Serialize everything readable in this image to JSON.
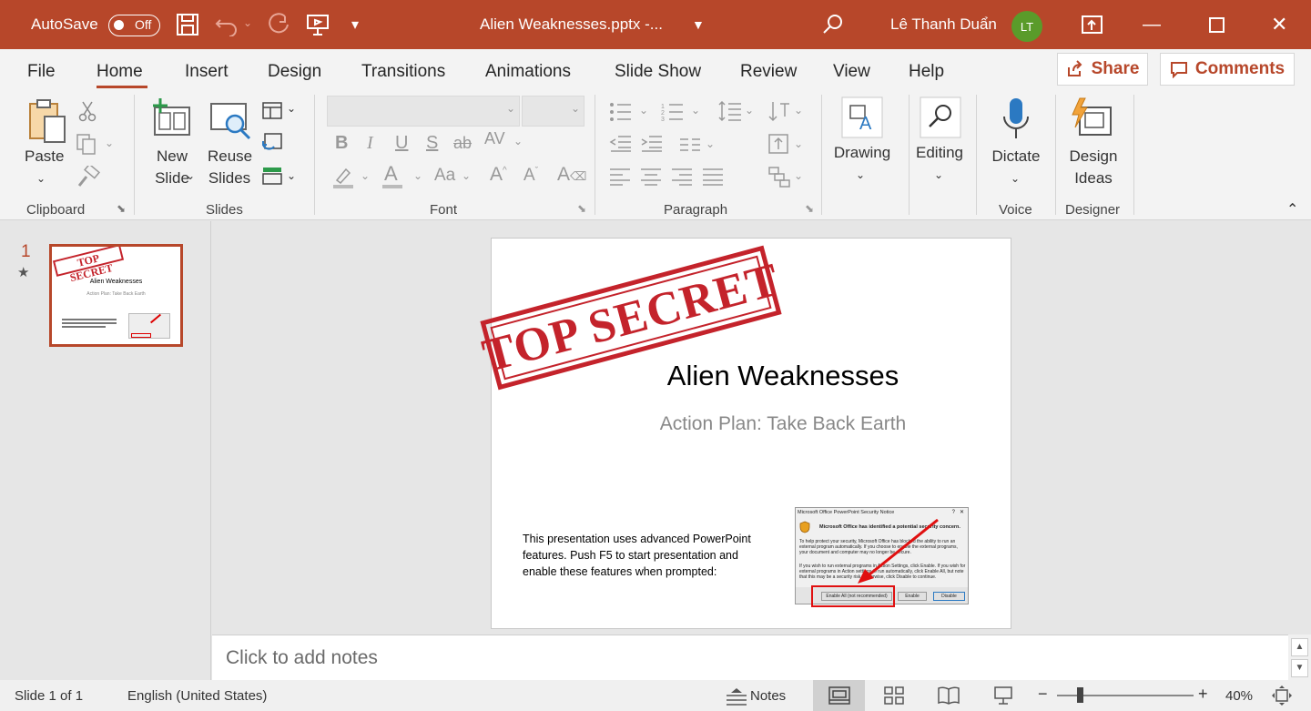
{
  "titlebar": {
    "autosave_label": "AutoSave",
    "autosave_state": "Off",
    "doc_title": "Alien Weaknesses.pptx  -...",
    "user_name": "Lê Thanh Duẩn",
    "user_initials": "LT"
  },
  "tabs": [
    "File",
    "Home",
    "Insert",
    "Design",
    "Transitions",
    "Animations",
    "Slide Show",
    "Review",
    "View",
    "Help"
  ],
  "active_tab": "Home",
  "share_label": "Share",
  "comments_label": "Comments",
  "ribbon": {
    "paste": "Paste",
    "clipboard": "Clipboard",
    "new_slide_1": "New",
    "new_slide_2": "Slide",
    "reuse_1": "Reuse",
    "reuse_2": "Slides",
    "slides": "Slides",
    "font": "Font",
    "paragraph": "Paragraph",
    "drawing": "Drawing",
    "editing": "Editing",
    "dictate": "Dictate",
    "voice": "Voice",
    "design_1": "Design",
    "design_2": "Ideas",
    "designer": "Designer"
  },
  "thumbnail": {
    "number": "1",
    "title": "Alien Weaknesses",
    "subtitle": "Action Plan: Take Back Earth",
    "stamp": "TOP SECRET"
  },
  "slide": {
    "stamp": "TOP SECRET",
    "title": "Alien Weaknesses",
    "subtitle": "Action Plan: Take Back Earth",
    "body": "This presentation uses advanced PowerPoint features. Push F5 to start presentation and enable these features when prompted:",
    "dialog": {
      "title": "Microsoft Office PowerPoint Security Notice",
      "heading": "Microsoft Office has identified a potential security concern.",
      "p1": "To help protect your security, Microsoft Office has blocked the ability to run an external program automatically.  If you choose to enable the external programs, your document and computer may no longer be secure.",
      "p2": "If you wish to run external programs in Action Settings, click Enable. If you wish for external programs in Action settings to run automatically, click Enable All, but note that this may be a security risk.  Otherwise, click Disable to continue.",
      "btn_enable_all": "Enable All (not recommended)",
      "btn_enable": "Enable",
      "btn_disable": "Disable"
    }
  },
  "notes_placeholder": "Click to add notes",
  "status": {
    "slide_info": "Slide 1 of 1",
    "language": "English (United States)",
    "notes": "Notes",
    "zoom": "40%"
  }
}
